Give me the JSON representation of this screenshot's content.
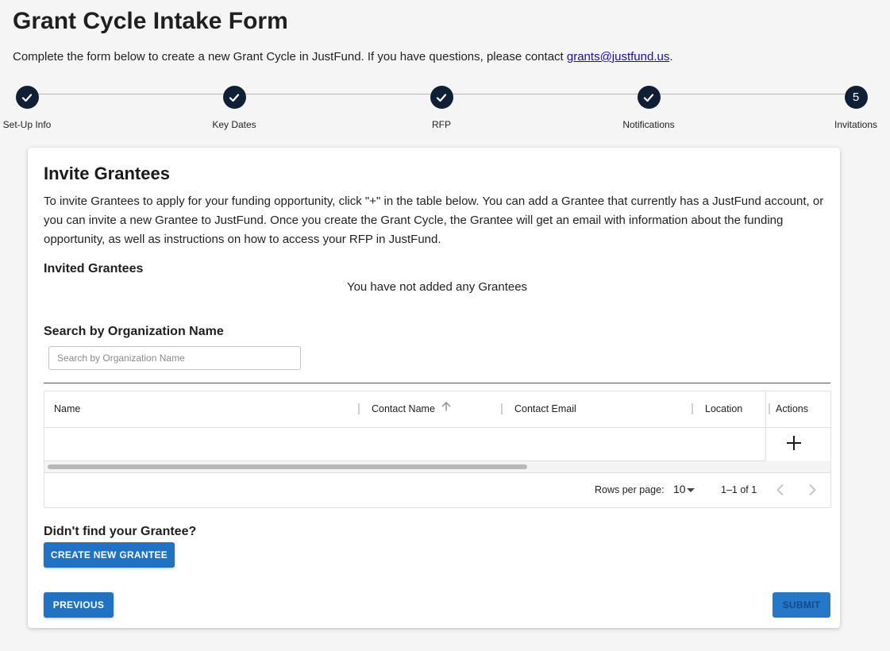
{
  "header": {
    "title": "Grant Cycle Intake Form",
    "intro_text": "Complete the form below to create a new Grant Cycle in JustFund. If you have questions, please contact ",
    "contact_email": "grants@justfund.us",
    "intro_end": "."
  },
  "stepper": {
    "steps": [
      {
        "label": "Set-Up Info",
        "status": "complete",
        "icon": "check-icon"
      },
      {
        "label": "Key Dates",
        "status": "complete",
        "icon": "check-icon"
      },
      {
        "label": "RFP",
        "status": "complete",
        "icon": "check-icon"
      },
      {
        "label": "Notifications",
        "status": "complete",
        "icon": "check-icon"
      },
      {
        "label": "Invitations",
        "status": "current",
        "number": "5"
      }
    ]
  },
  "card": {
    "title": "Invite Grantees",
    "description": "To invite Grantees to apply for your funding opportunity, click \"+\" in the table below. You can add a Grantee that currently has a JustFund account, or you can invite a new Grantee to JustFund. Once you create the Grant Cycle, the Grantee will get an email with information about the funding opportunity, as well as instructions on how to access your RFP in JustFund.",
    "invited_heading": "Invited Grantees",
    "empty_message": "You have not added any Grantees",
    "search_heading": "Search by Organization Name",
    "search_placeholder": "Search by Organization Name",
    "search_value": ""
  },
  "table": {
    "columns": [
      {
        "label": "Name"
      },
      {
        "label": "Contact Name",
        "sort": "ascending"
      },
      {
        "label": "Contact Email"
      },
      {
        "label": "Location"
      },
      {
        "label": "Actions"
      }
    ],
    "add_action_icon": "plus-icon",
    "pagination": {
      "rows_per_page_label": "Rows per page:",
      "rows_per_page_value": "10",
      "range_text": "1–1 of 1"
    }
  },
  "not_found": {
    "heading": "Didn't find your Grantee?",
    "create_button": "CREATE NEW GRANTEE"
  },
  "footer": {
    "previous_button": "PREVIOUS",
    "submit_button": "SUBMIT"
  },
  "colors": {
    "primary": "#1f73c2",
    "step_circle": "#0f1f35",
    "link": "#1a0dab"
  }
}
